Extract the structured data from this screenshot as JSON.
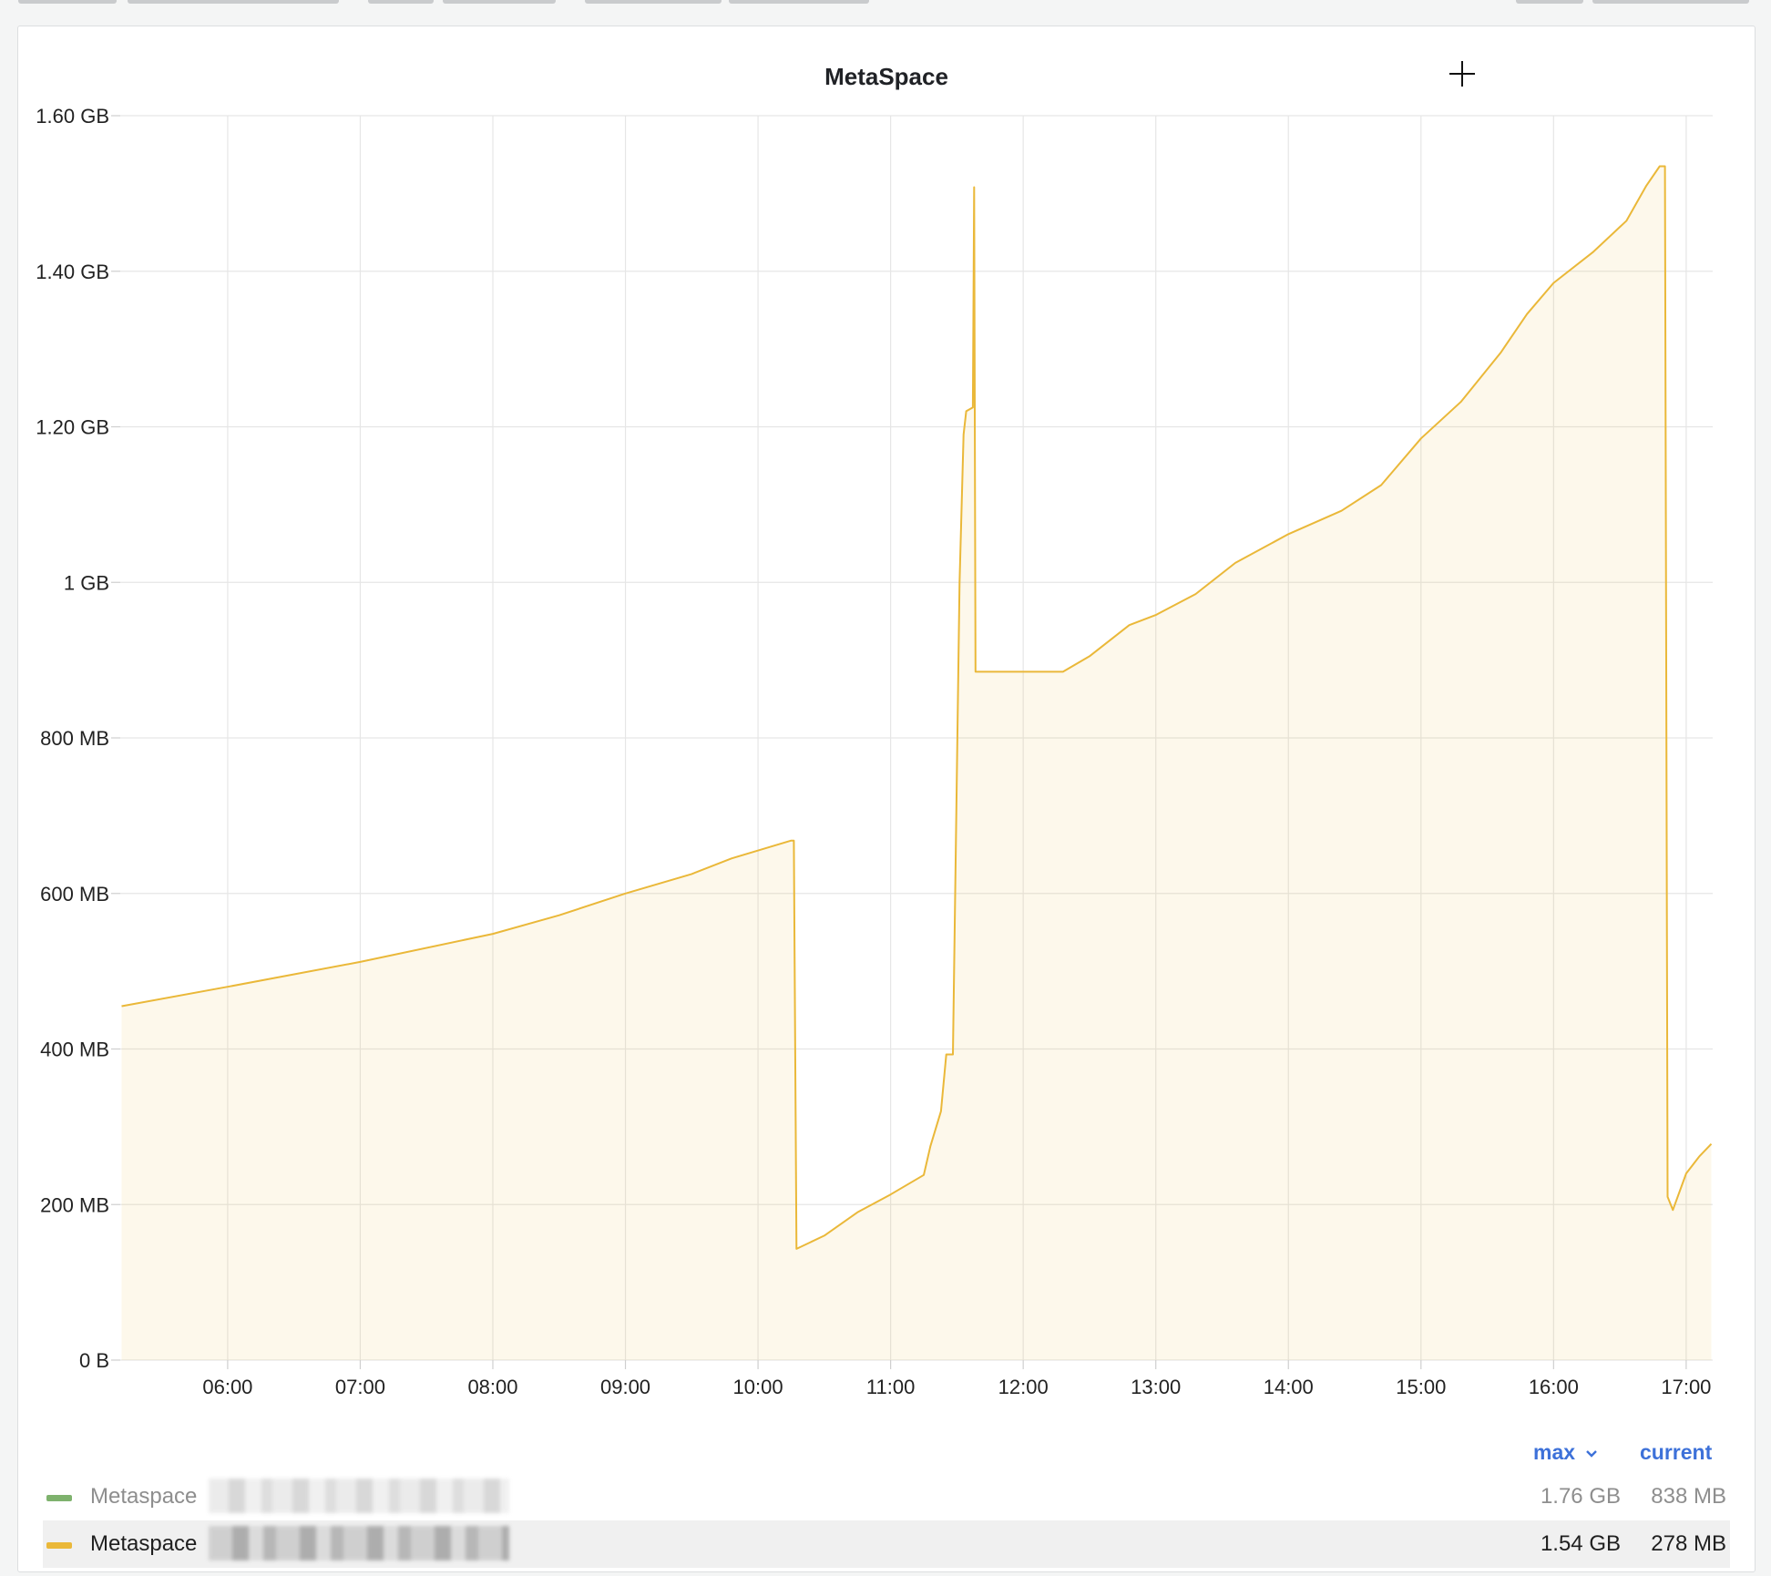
{
  "panel": {
    "title": "MetaSpace"
  },
  "legend": {
    "columns": {
      "max": "max",
      "current": "current"
    },
    "items": [
      {
        "name": "Metaspace",
        "color": "#7eb26d",
        "max": "1.76 GB",
        "current": "838 MB",
        "dimmed": true
      },
      {
        "name": "Metaspace",
        "color": "#eab839",
        "max": "1.54 GB",
        "current": "278 MB",
        "dimmed": false
      }
    ]
  },
  "chart_data": {
    "type": "area",
    "title": "MetaSpace",
    "xlabel": "",
    "ylabel": "",
    "x_ticks": [
      "06:00",
      "07:00",
      "08:00",
      "09:00",
      "10:00",
      "11:00",
      "12:00",
      "13:00",
      "14:00",
      "15:00",
      "16:00",
      "17:00"
    ],
    "y_ticks": [
      {
        "value": 0,
        "label": "0 B"
      },
      {
        "value": 200,
        "label": "200 MB"
      },
      {
        "value": 400,
        "label": "400 MB"
      },
      {
        "value": 600,
        "label": "600 MB"
      },
      {
        "value": 800,
        "label": "800 MB"
      },
      {
        "value": 1000,
        "label": "1 GB"
      },
      {
        "value": 1200,
        "label": "1.20 GB"
      },
      {
        "value": 1400,
        "label": "1.40 GB"
      },
      {
        "value": 1600,
        "label": "1.60 GB"
      }
    ],
    "x_unit": "hours",
    "y_unit": "MB",
    "xlim": [
      5.19,
      17.2
    ],
    "ylim": [
      0,
      1600
    ],
    "grid": true,
    "series": [
      {
        "name": "Metaspace",
        "color": "#eab839",
        "points": [
          [
            5.2,
            455
          ],
          [
            6.0,
            480
          ],
          [
            7.0,
            512
          ],
          [
            8.0,
            548
          ],
          [
            8.5,
            572
          ],
          [
            9.0,
            600
          ],
          [
            9.5,
            625
          ],
          [
            9.8,
            645
          ],
          [
            10.25,
            668
          ],
          [
            10.27,
            668
          ],
          [
            10.29,
            143
          ],
          [
            10.5,
            160
          ],
          [
            10.75,
            190
          ],
          [
            11.0,
            213
          ],
          [
            11.25,
            238
          ],
          [
            11.3,
            275
          ],
          [
            11.38,
            320
          ],
          [
            11.42,
            393
          ],
          [
            11.47,
            393
          ],
          [
            11.52,
            1000
          ],
          [
            11.55,
            1190
          ],
          [
            11.57,
            1220
          ],
          [
            11.62,
            1225
          ],
          [
            11.63,
            1508
          ],
          [
            11.64,
            885
          ],
          [
            12.3,
            885
          ],
          [
            12.5,
            905
          ],
          [
            12.8,
            945
          ],
          [
            13.0,
            958
          ],
          [
            13.3,
            985
          ],
          [
            13.6,
            1025
          ],
          [
            14.0,
            1062
          ],
          [
            14.4,
            1092
          ],
          [
            14.7,
            1125
          ],
          [
            15.0,
            1185
          ],
          [
            15.3,
            1232
          ],
          [
            15.6,
            1295
          ],
          [
            15.8,
            1345
          ],
          [
            16.0,
            1385
          ],
          [
            16.3,
            1425
          ],
          [
            16.55,
            1465
          ],
          [
            16.7,
            1510
          ],
          [
            16.8,
            1535
          ],
          [
            16.84,
            1535
          ],
          [
            16.86,
            210
          ],
          [
            16.9,
            193
          ],
          [
            17.0,
            240
          ],
          [
            17.1,
            262
          ],
          [
            17.19,
            278
          ]
        ]
      }
    ]
  }
}
